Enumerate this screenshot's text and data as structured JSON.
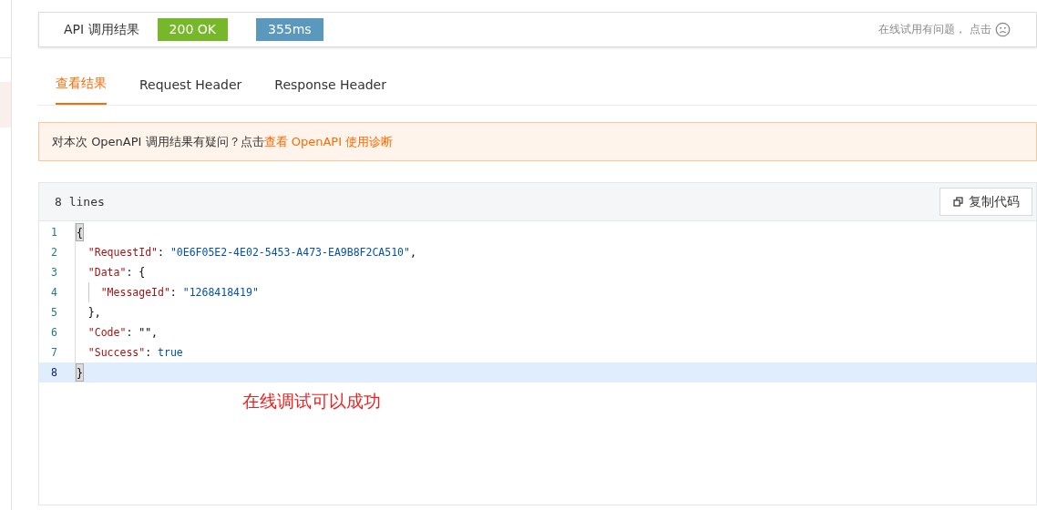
{
  "result_bar": {
    "title": "API 调用结果",
    "status": "200 OK",
    "duration": "355ms",
    "feedback": "在线试用有问题， 点击"
  },
  "tabs": [
    {
      "label": "查看结果",
      "selected": true
    },
    {
      "label": "Request Header",
      "selected": false
    },
    {
      "label": "Response Header",
      "selected": false
    }
  ],
  "notice": {
    "text": "对本次 OpenAPI 调用结果有疑问？点击",
    "link": "查看 OpenAPI 使用诊断"
  },
  "code": {
    "line_count": "8 lines",
    "copy_button": "复制代码",
    "lines": [
      {
        "number": "1",
        "active": false,
        "tokens": [
          {
            "kind": "bracket-match",
            "text": "{"
          }
        ]
      },
      {
        "number": "2",
        "active": false,
        "tokens": [
          {
            "kind": "key",
            "text": "  \"RequestId\""
          },
          {
            "kind": "punct",
            "text": ": "
          },
          {
            "kind": "string",
            "text": "\"0E6F05E2-4E02-5453-A473-EA9B8F2CA510\""
          },
          {
            "kind": "punct",
            "text": ","
          }
        ]
      },
      {
        "number": "3",
        "active": false,
        "tokens": [
          {
            "kind": "key",
            "text": "  \"Data\""
          },
          {
            "kind": "punct",
            "text": ": {"
          }
        ]
      },
      {
        "number": "4",
        "active": false,
        "tokens": [
          {
            "kind": "key",
            "text": "    \"MessageId\""
          },
          {
            "kind": "punct",
            "text": ": "
          },
          {
            "kind": "string",
            "text": "\"1268418419\""
          }
        ]
      },
      {
        "number": "5",
        "active": false,
        "tokens": [
          {
            "kind": "punct",
            "text": "  },"
          }
        ]
      },
      {
        "number": "6",
        "active": false,
        "tokens": [
          {
            "kind": "key",
            "text": "  \"Code\""
          },
          {
            "kind": "punct",
            "text": ": \"\","
          }
        ]
      },
      {
        "number": "7",
        "active": false,
        "tokens": [
          {
            "kind": "key",
            "text": "  \"Success\""
          },
          {
            "kind": "punct",
            "text": ": "
          },
          {
            "kind": "bool",
            "text": "true"
          }
        ]
      },
      {
        "number": "8",
        "active": true,
        "tokens": [
          {
            "kind": "bracket-match",
            "text": "}"
          }
        ]
      }
    ]
  },
  "annotation": "在线调试可以成功"
}
